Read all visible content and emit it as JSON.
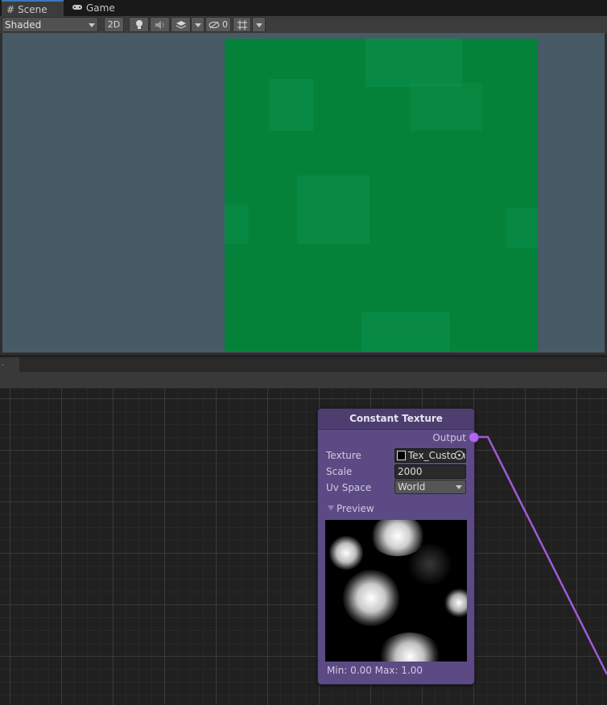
{
  "tabs": [
    {
      "label": "Scene",
      "icon": "grid-hash-icon",
      "active": true
    },
    {
      "label": "Game",
      "icon": "gamepad-icon",
      "active": false
    }
  ],
  "toolbar": {
    "shading_mode": "Shaded",
    "toggle_2d": "2D",
    "hidden_count": "0"
  },
  "node": {
    "title": "Constant Texture",
    "output_label": "Output",
    "fields": {
      "texture_label": "Texture",
      "texture_value": "Tex_Custom",
      "scale_label": "Scale",
      "scale_value": "2000",
      "uvspace_label": "Uv Space",
      "uvspace_value": "World"
    },
    "preview_label": "Preview",
    "minmax": "Min: 0.00 Max: 1.00"
  },
  "graph_tab_label": ".",
  "colors": {
    "node_body": "#5c4a84",
    "node_header": "#4d3e6f",
    "output_port": "#b267f0",
    "edge": "#a05bd6",
    "viewport_bg": "#495a67",
    "texture_green": "#05823a"
  }
}
